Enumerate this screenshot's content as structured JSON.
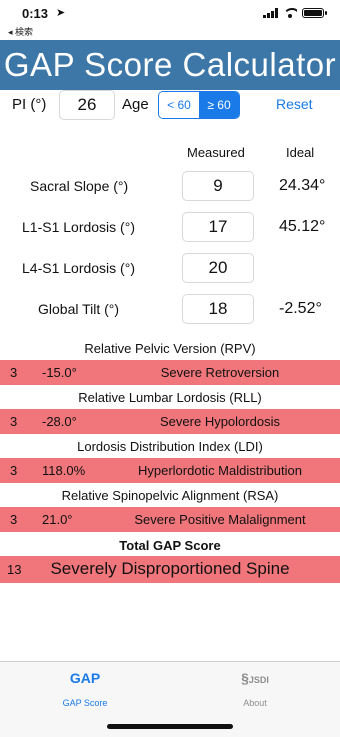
{
  "status_bar": {
    "time": "0:13",
    "back_label": "◂ 検索"
  },
  "header": {
    "title": "GAP Score Calculator"
  },
  "pi": {
    "label": "PI (°)",
    "value": "26"
  },
  "age": {
    "label": "Age",
    "options": [
      "< 60",
      "≥ 60"
    ],
    "selected": "≥ 60"
  },
  "reset_label": "Reset",
  "columns": {
    "measured": "Measured",
    "ideal": "Ideal"
  },
  "measurements": [
    {
      "label": "Sacral Slope (°)",
      "value": "9",
      "ideal": "24.34°"
    },
    {
      "label": "L1-S1 Lordosis (°)",
      "value": "17",
      "ideal": "45.12°"
    },
    {
      "label": "L4-S1 Lordosis (°)",
      "value": "20",
      "ideal": ""
    },
    {
      "label": "Global Tilt (°)",
      "value": "18",
      "ideal": "-2.52°"
    }
  ],
  "results": [
    {
      "title": "Relative Pelvic Version (RPV)",
      "score": "3",
      "value": "-15.0°",
      "description": "Severe Retroversion"
    },
    {
      "title": "Relative Lumbar Lordosis (RLL)",
      "score": "3",
      "value": "-28.0°",
      "description": "Severe Hypolordosis"
    },
    {
      "title": "Lordosis Distribution Index (LDI)",
      "score": "3",
      "value": "118.0%",
      "description": "Hyperlordotic Maldistribution"
    },
    {
      "title": "Relative Spinopelvic Alignment (RSA)",
      "score": "3",
      "value": "21.0°",
      "description": "Severe Positive Malalignment"
    }
  ],
  "total": {
    "title": "Total GAP Score",
    "score": "13",
    "description": "Severely Disproportioned Spine"
  },
  "tabs": [
    {
      "icon_text": "GAP",
      "label": "GAP Score"
    },
    {
      "icon_text": "JSDI",
      "label": "About"
    }
  ],
  "colors": {
    "header": "#3d77a8",
    "accent": "#1a7ae8",
    "severity_band": "#f0767b"
  }
}
